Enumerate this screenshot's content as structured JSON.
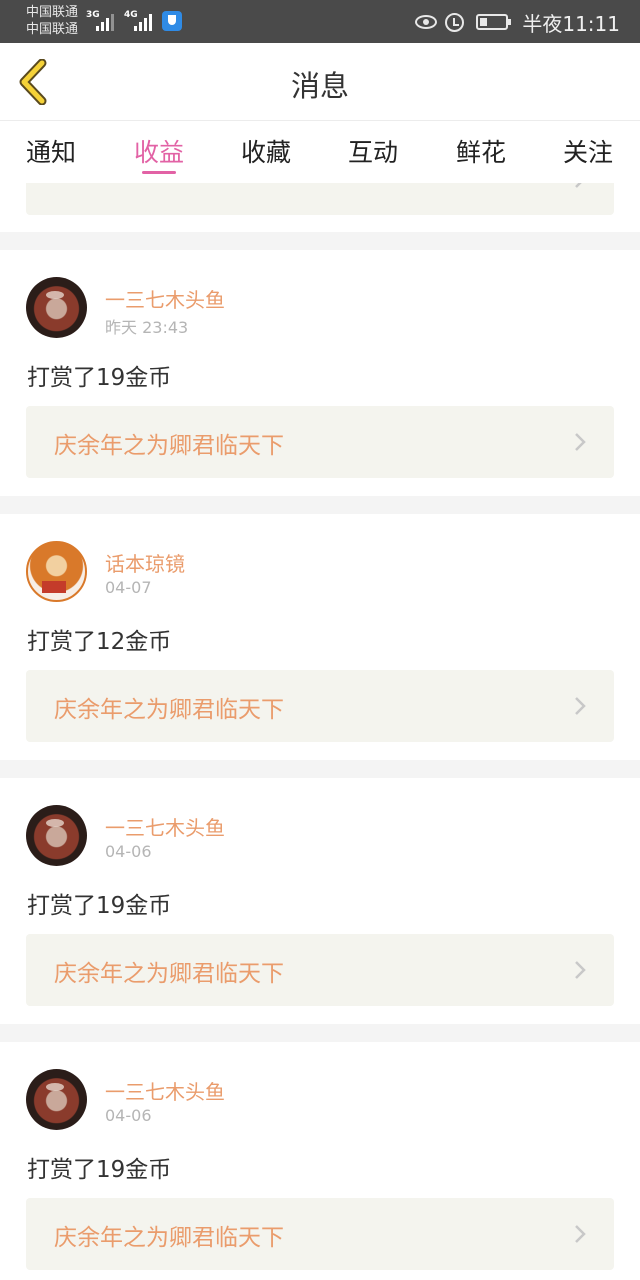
{
  "statusbar": {
    "carrier1": "中国联通",
    "carrier2": "中国联通",
    "net1": "3G",
    "net2": "4G",
    "time": "半夜11:11",
    "battery_level": 0.3
  },
  "header": {
    "title": "消息"
  },
  "tabs": [
    {
      "label": "通知"
    },
    {
      "label": "收益"
    },
    {
      "label": "收藏"
    },
    {
      "label": "互动"
    },
    {
      "label": "鲜花"
    },
    {
      "label": "关注"
    }
  ],
  "active_tab": "收益",
  "messages": [
    {
      "user": "一三七木头鱼",
      "date": "昨天 23:43",
      "action": "打赏了19金币",
      "book": "庆余年之为卿君临天下"
    },
    {
      "user": "话本琼镜",
      "date": "04-07",
      "action": "打赏了12金币",
      "book": "庆余年之为卿君临天下"
    },
    {
      "user": "一三七木头鱼",
      "date": "04-06",
      "action": "打赏了19金币",
      "book": "庆余年之为卿君临天下"
    },
    {
      "user": "一三七木头鱼",
      "date": "04-06",
      "action": "打赏了19金币",
      "book": "庆余年之为卿君临天下"
    }
  ],
  "colors": {
    "accent": "#e262a5",
    "username": "#ea9c6c",
    "book_title": "#ea9c6c",
    "book_bg": "#f4f4ee"
  }
}
